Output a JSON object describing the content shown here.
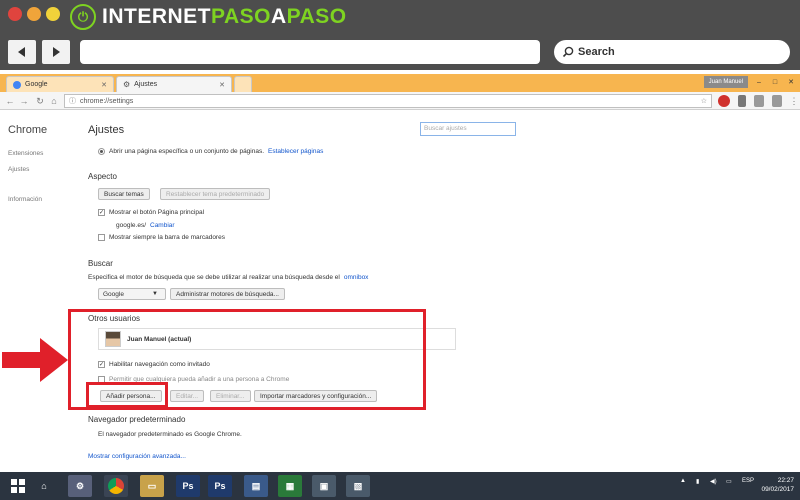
{
  "frame": {
    "brand_prefix": "INTERNET",
    "brand_accent": "PASO",
    "brand_mid": "A",
    "brand_suffix": "PASO",
    "search_label": "Search",
    "accent_color": "#7ed321"
  },
  "chrome": {
    "tabs": [
      {
        "label": "Google",
        "icon": "google-icon"
      },
      {
        "label": "Ajustes",
        "icon": "gear-icon"
      }
    ],
    "user_pill": "Juan Manuel",
    "url": "chrome://settings",
    "tab_bar_color": "#f7b54f"
  },
  "sidebar": {
    "title": "Chrome",
    "items": [
      {
        "label": "Extensiones"
      },
      {
        "label": "Ajustes"
      },
      {
        "label": "Información"
      }
    ]
  },
  "settings": {
    "title": "Ajustes",
    "search_placeholder": "Buscar ajustes",
    "startup_option": "Abrir una página específica o un conjunto de páginas.",
    "startup_link": "Establecer páginas",
    "appearance": {
      "heading": "Aspecto",
      "themes_button": "Buscar temas",
      "reset_theme_button": "Restablecer tema predeterminado",
      "home_button_label": "Mostrar el botón Página principal",
      "home_page": "google.es/",
      "change_link": "Cambiar",
      "bookmarks_bar_label": "Mostrar siempre la barra de marcadores"
    },
    "search": {
      "heading": "Buscar",
      "description": "Especifica el motor de búsqueda que se debe utilizar al realizar una búsqueda desde el",
      "omnibox_link": "omnibox",
      "engine_selected": "Google",
      "manage_button": "Administrar motores de búsqueda..."
    },
    "users": {
      "heading": "Otros usuarios",
      "current_user": "Juan Manuel (actual)",
      "guest_label": "Habilitar navegación como invitado",
      "anyone_add_label": "Permitir que cualquiera pueda añadir a una persona a Chrome",
      "add_person_button": "Añadir persona...",
      "edit_button": "Editar...",
      "delete_button": "Eliminar...",
      "import_button": "Importar marcadores y configuración..."
    },
    "default_browser": {
      "heading": "Navegador predeterminado",
      "status": "El navegador predeterminado es Google Chrome."
    },
    "advanced_link": "Mostrar configuración avanzada..."
  },
  "taskbar": {
    "language": "ESP",
    "time": "22:27",
    "date": "09/02/2017"
  },
  "annotation_color": "#e0202a"
}
